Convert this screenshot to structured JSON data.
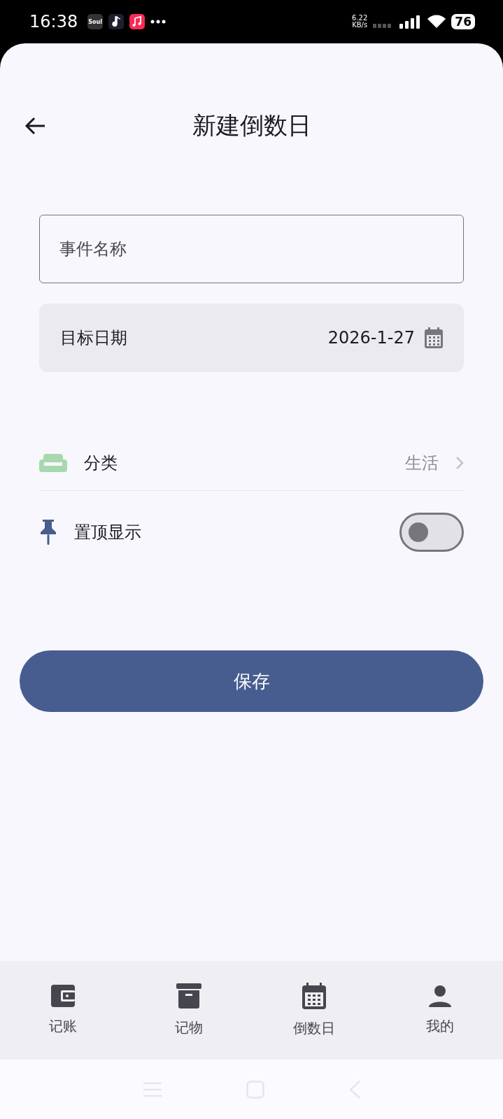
{
  "status_bar": {
    "time": "16:38",
    "app_badge": "Soul",
    "network_speed": "6.22",
    "network_unit": "KB/s",
    "battery": "76"
  },
  "header": {
    "title": "新建倒数日"
  },
  "event_name_field": {
    "placeholder": "事件名称"
  },
  "target_date": {
    "label": "目标日期",
    "value": "2026-1-27"
  },
  "settings": [
    {
      "kind": "link",
      "label": "分类",
      "value": "生活"
    },
    {
      "kind": "toggle",
      "label": "置顶显示",
      "on": false
    }
  ],
  "save_button": "保存",
  "bottom_nav": [
    {
      "label": "记账"
    },
    {
      "label": "记物"
    },
    {
      "label": "倒数日"
    },
    {
      "label": "我的"
    }
  ]
}
